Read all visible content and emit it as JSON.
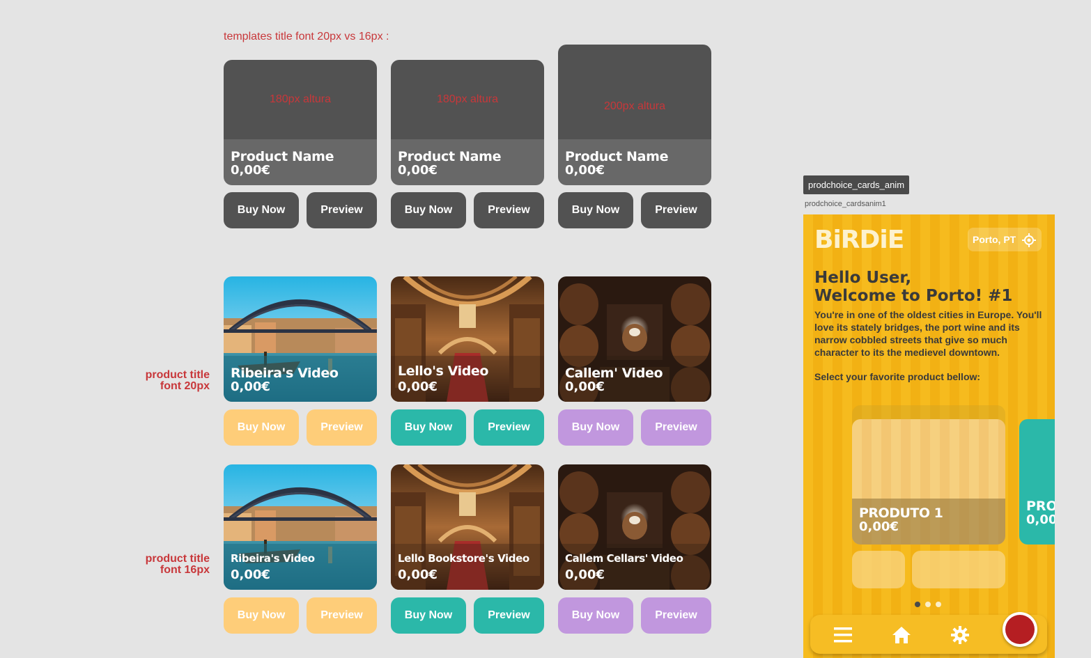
{
  "notes": {
    "top": "templates  title font 20px vs 16px :",
    "side20": [
      "product title",
      "font 20px"
    ],
    "side16": [
      "product title",
      "font 16px"
    ]
  },
  "buttons": {
    "buy": "Buy Now",
    "preview": "Preview"
  },
  "templates": [
    {
      "height_label": "180px altura",
      "name": "Product Name",
      "price": "0,00€"
    },
    {
      "height_label": "180px altura",
      "name": "Product Name",
      "price": "0,00€"
    },
    {
      "height_label": "200px altura",
      "name": "Product Name",
      "price": "0,00€"
    }
  ],
  "row20": [
    {
      "name": "Ribeira's Video",
      "price": "0,00€",
      "color": "#fecd79"
    },
    {
      "name": "Lello's Video",
      "price": "0,00€",
      "color": "#2bb8a9"
    },
    {
      "name": "Callem' Video",
      "price": "0,00€",
      "color": "#c197de"
    }
  ],
  "row16": [
    {
      "name": "Ribeira's Video",
      "price": "0,00€",
      "color": "#fecd79"
    },
    {
      "name": "Lello Bookstore's Video",
      "price": "0,00€",
      "color": "#2bb8a9"
    },
    {
      "name": "Callem Cellars' Video",
      "price": "0,00€",
      "color": "#c197de"
    }
  ],
  "phone": {
    "tooltip": "prodchoice_cards_anim",
    "frame_label": "prodchoice_cardsanim1",
    "logo": "BiRDiE",
    "location": "Porto, PT",
    "hello_line1": "Hello User,",
    "hello_line2": "Welcome to Porto! #1",
    "intro": "You're in one of the oldest cities in Europe. You'll love its stately bridges, the port wine and its narrow cobbled streets that give so much character to its the medievel downtown.",
    "select": "Select your favorite product bellow:",
    "card": {
      "name": "PRODUTO 1",
      "price": "0,00€"
    },
    "next_card": {
      "name": "PRO",
      "price": "0,00"
    },
    "carousel": {
      "pages": 3,
      "active": 1
    },
    "nav_icons": [
      "menu-icon",
      "home-icon",
      "gear-icon",
      "record-button"
    ]
  }
}
